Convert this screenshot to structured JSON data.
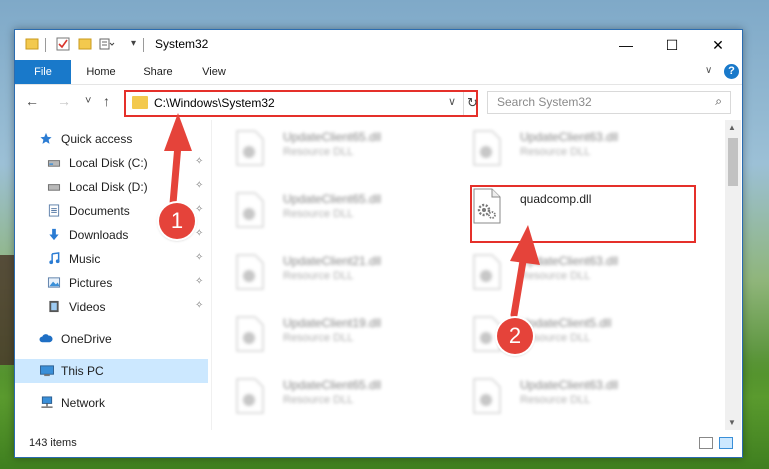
{
  "window": {
    "title": "System32",
    "buttons": {
      "minimize": "—",
      "maximize": "☐",
      "close": "✕"
    }
  },
  "ribbon": {
    "tabs": [
      "File",
      "Home",
      "Share",
      "View"
    ],
    "expand_glyph": "∨",
    "help_glyph": "?"
  },
  "nav": {
    "back_glyph": "←",
    "forward_glyph": "→",
    "recent_glyph": "˅",
    "up_glyph": "↑",
    "address": "C:\\Windows\\System32",
    "address_dropdown_glyph": "∨",
    "refresh_glyph": "↻",
    "search_placeholder": "Search System32",
    "search_glyph": "⌕"
  },
  "sidebar": {
    "items": [
      {
        "label": "Quick access",
        "icon": "star-icon"
      },
      {
        "label": "Local Disk (C:)",
        "icon": "drive-icon"
      },
      {
        "label": "Local Disk (D:)",
        "icon": "drive-icon"
      },
      {
        "label": "Documents",
        "icon": "documents-icon"
      },
      {
        "label": "Downloads",
        "icon": "download-icon"
      },
      {
        "label": "Music",
        "icon": "music-icon"
      },
      {
        "label": "Pictures",
        "icon": "pictures-icon"
      },
      {
        "label": "Videos",
        "icon": "videos-icon"
      },
      {
        "label": "OneDrive",
        "icon": "cloud-icon"
      },
      {
        "label": "This PC",
        "icon": "computer-icon"
      },
      {
        "label": "Network",
        "icon": "network-icon"
      }
    ],
    "pin_glyph": "✧"
  },
  "files": [
    {
      "name": "UpdateClient65.dll",
      "type": "Resource DLL"
    },
    {
      "name": "UpdateClient63.dll",
      "type": "Resource DLL"
    },
    {
      "name": "UpdateClient65.dll",
      "type": "Resource DLL"
    },
    {
      "name": "quadcomp.dll",
      "type": ""
    },
    {
      "name": "UpdateClient21.dll",
      "type": "Resource DLL"
    },
    {
      "name": "UpdateClient63.dll",
      "type": "Resource DLL"
    },
    {
      "name": "UpdateClient19.dll",
      "type": "Resource DLL"
    },
    {
      "name": "UpdateClient5.dll",
      "type": "Resource DLL"
    },
    {
      "name": "UpdateClient65.dll",
      "type": "Resource DLL"
    },
    {
      "name": "UpdateClient63.dll",
      "type": "Resource DLL"
    }
  ],
  "status": {
    "items_count": "143 items"
  },
  "annotations": {
    "step1": "1",
    "step2": "2",
    "color": "#e5433a"
  }
}
